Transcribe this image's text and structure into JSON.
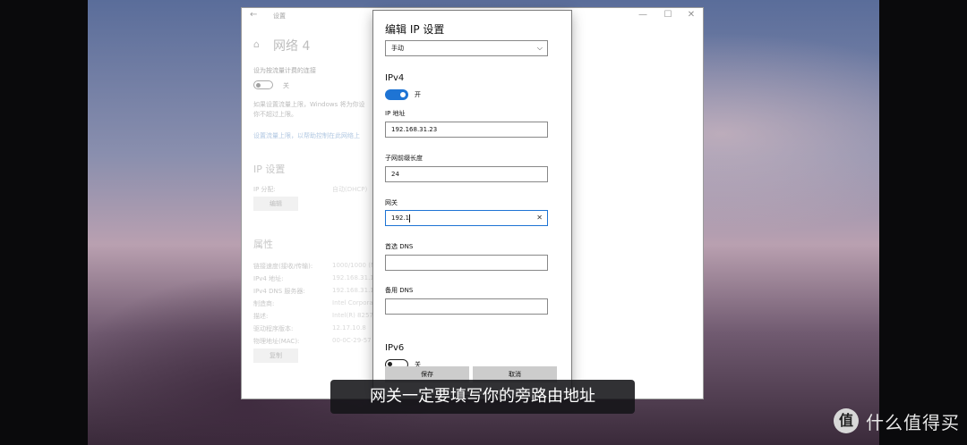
{
  "settings_window": {
    "title": "设置",
    "controls": {
      "minimize": "—",
      "maximize": "☐",
      "close": "✕"
    },
    "page_title": "网络 4",
    "metered_label": "设为按流量计费的连接",
    "metered_toggle_state": "关",
    "metered_desc_line1": "如果设置流量上限，Windows 将为你设",
    "metered_desc_line2": "你不超过上限。",
    "data_limit_link": "设置流量上限，以帮助控制在此网络上",
    "ip_section_title": "IP 设置",
    "ip_assign_label": "IP 分配:",
    "ip_assign_value": "自动(DHCP)",
    "edit_button": "编辑",
    "props_section_title": "属性",
    "properties": [
      {
        "label": "链接速度(接收/传输):",
        "value": "1000/1000 (M"
      },
      {
        "label": "IPv4 地址:",
        "value": "192.168.31.15"
      },
      {
        "label": "IPv4 DNS 服务器:",
        "value": "192.168.31.1"
      },
      {
        "label": "制造商:",
        "value": "Intel Corpora"
      },
      {
        "label": "描述:",
        "value": "Intel(R) 8257"
      },
      {
        "label": "驱动程序版本:",
        "value": "12.17.10.8"
      },
      {
        "label": "物理地址(MAC):",
        "value": "00-0C-29-57"
      }
    ],
    "copy_button": "复制"
  },
  "dialog": {
    "title": "编辑 IP 设置",
    "mode_select": "手动",
    "ipv4_label": "IPv4",
    "ipv4_toggle_state": "开",
    "ip_address_label": "IP 地址",
    "ip_address_value": "192.168.31.23",
    "prefix_label": "子网前缀长度",
    "prefix_value": "24",
    "gateway_label": "网关",
    "gateway_value": "192.1",
    "preferred_dns_label": "首选 DNS",
    "preferred_dns_value": "",
    "alternate_dns_label": "备用 DNS",
    "alternate_dns_value": "",
    "ipv6_label": "IPv6",
    "ipv6_toggle_state": "关",
    "save_button": "保存",
    "cancel_button": "取消"
  },
  "subtitle": "网关一定要填写你的旁路由地址",
  "watermark": {
    "logo_char": "值",
    "text": "什么值得买"
  },
  "colors": {
    "accent": "#1e74d4",
    "link": "#6f99c9"
  }
}
